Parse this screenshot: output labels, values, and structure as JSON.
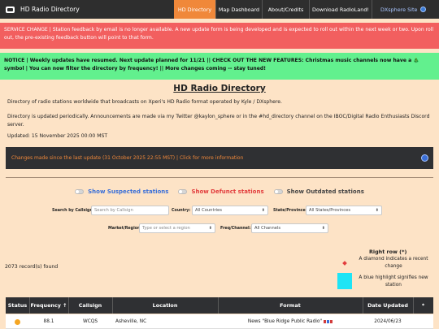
{
  "nav": {
    "brand": "HD Radio Directory",
    "items": [
      "HD Directory",
      "Map Dashboard",
      "About/Credits",
      "Download RadioLand!"
    ],
    "dx_site": "DXsphere Site",
    "colors": {
      "bar": "#2e2e2e",
      "active": "#f0883a"
    }
  },
  "banners": {
    "service_change": "SERVICE CHANGE | Station feedback by email is no longer available. A new update form is being developed and is expected to roll out within the next week or two. Upon roll out, the pre-existing feedback button will point to that form.",
    "notice": "NOTICE | Weekly updates have resumed. Next update planned for 11/21 || CHECK OUT THE NEW FEATURES: Christmas music channels now have a 🎄 symbol | You can now filter the directory by frequency! || More changes coming -- stay tuned!"
  },
  "page": {
    "title": "HD Radio Directory",
    "intro_1": "Directory of radio stations worldwide that broadcasts on Xperi's HD Radio format operated by Kyle / DXsphere.",
    "intro_2": "Directory is updated periodically. Announcements are made via my Twitter @kaylon_sphere or in the #hd_directory channel on the IBOC/Digital Radio Enthusiasts Discord server.",
    "updated": "Updated: 15 November 2025 00:00 MST"
  },
  "changes_bar": {
    "text": "Changes made since the last update (31 October 2025 22:55 MST) | Click for more information"
  },
  "toggles": [
    {
      "label": "Show Suspected stations",
      "checked": false
    },
    {
      "label": "Show Defunct stations",
      "checked": false
    },
    {
      "label": "Show Outdated stations",
      "checked": false
    }
  ],
  "filters": {
    "callsign_label": "Search by Callsign:",
    "callsign_placeholder": "Search by Callsign",
    "country_label": "Country:",
    "country_value": "All Countries",
    "state_label": "State/Province:",
    "state_value": "All States/Provinces",
    "market_label": "Market/Region:",
    "market_placeholder": "Type or select a region",
    "freq_label": "Freq/Channel:",
    "freq_value": "All Channels"
  },
  "legend": {
    "title": "Right row (*)",
    "diamond_text": "A diamond indicates a recent change",
    "blue_text": "A blue highlight signifies new station",
    "blue_color": "#1ee4f5",
    "diamond_color": "#e23d3d"
  },
  "records": "2073 record(s) found",
  "table": {
    "headers": [
      "Status",
      "Frequency ↑",
      "Callsign",
      "Location",
      "Format",
      "Date Updated",
      "*"
    ],
    "rows": [
      {
        "frequency": "88.1",
        "callsign": "WCQS",
        "location": "Asheville, NC",
        "format": "News \"Blue Ridge Public Radio\"",
        "date": "2024/06/23"
      }
    ]
  }
}
